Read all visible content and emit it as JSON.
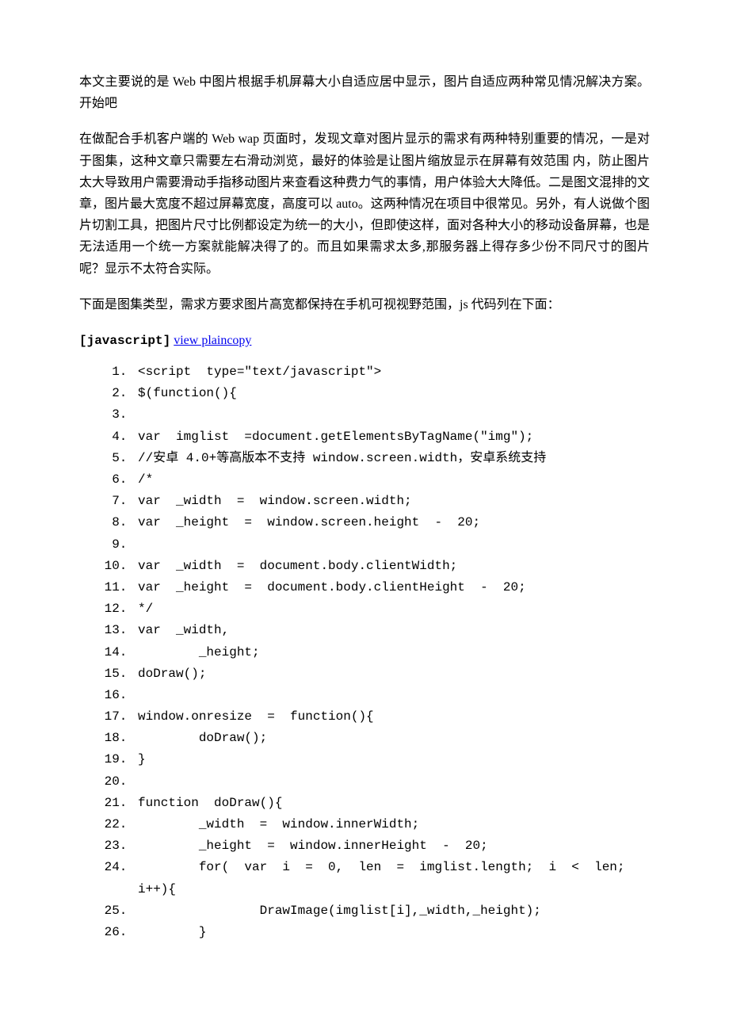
{
  "intro": "本文主要说的是 Web 中图片根据手机屏幕大小自适应居中显示，图片自适应两种常见情况解决方案。开始吧",
  "para2": "在做配合手机客户端的 Web wap 页面时，发现文章对图片显示的需求有两种特别重要的情况，一是对于图集，这种文章只需要左右滑动浏览，最好的体验是让图片缩放显示在屏幕有效范围 内，防止图片太大导致用户需要滑动手指移动图片来查看这种费力气的事情，用户体验大大降低。二是图文混排的文章，图片最大宽度不超过屏幕宽度，高度可以 auto。这两种情况在项目中很常见。另外，有人说做个图片切割工具，把图片尺寸比例都设定为统一的大小，但即使这样，面对各种大小的移动设备屏幕，也是 无法适用一个统一方案就能解决得了的。而且如果需求太多,那服务器上得存多少份不同尺寸的图片呢？显示不太符合实际。",
  "para3": "下面是图集类型，需求方要求图片高宽都保持在手机可视视野范围，js 代码列在下面：",
  "codeHeader": {
    "lang": "[javascript]",
    "links": {
      "view": "view plain",
      "copy": "copy"
    }
  },
  "codeLines": [
    "<script  type=\"text/javascript\">",
    "$(function(){",
    "",
    "var  imglist  =document.getElementsByTagName(\"img\");",
    "//安卓 4.0+等高版本不支持 window.screen.width，安卓系统支持",
    "/*",
    "var  _width  =  window.screen.width;",
    "var  _height  =  window.screen.height  -  20;",
    "",
    "var  _width  =  document.body.clientWidth;",
    "var  _height  =  document.body.clientHeight  -  20;",
    "*/",
    "var  _width,",
    "        _height;",
    "doDraw();",
    "",
    "window.onresize  =  function(){",
    "        doDraw();",
    "}",
    "",
    "function  doDraw(){",
    "        _width  =  window.innerWidth;",
    "        _height  =  window.innerHeight  -  20;",
    "        for(  var  i  =  0,  len  =  imglist.length;  i  <  len;  i++){",
    "                DrawImage(imglist[i],_width,_height);",
    "        }"
  ]
}
